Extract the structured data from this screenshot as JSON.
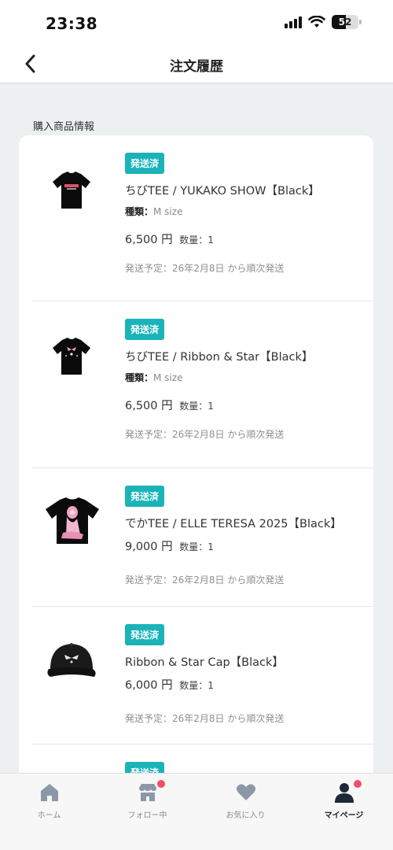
{
  "status_bar": {
    "time": "23:38",
    "battery": "52"
  },
  "header": {
    "title": "注文履歴"
  },
  "section": {
    "label": "購入商品情報"
  },
  "items": [
    {
      "status": "発送済",
      "name": "ちびTEE / YUKAKO SHOW【Black】",
      "variant_label": "種類：",
      "variant_value": "M size",
      "price": "6,500 円",
      "qty": "数量：1",
      "ship": "発送予定：26年2月8日 から順次発送"
    },
    {
      "status": "発送済",
      "name": "ちびTEE / Ribbon & Star【Black】",
      "variant_label": "種類：",
      "variant_value": "M size",
      "price": "6,500 円",
      "qty": "数量：1",
      "ship": "発送予定：26年2月8日 から順次発送"
    },
    {
      "status": "発送済",
      "name": "でかTEE / ELLE TERESA 2025【Black】",
      "price": "9,000 円",
      "qty": "数量：1",
      "ship": "発送予定：26年2月8日 から順次発送"
    },
    {
      "status": "発送済",
      "name": "Ribbon & Star Cap【Black】",
      "price": "6,000 円",
      "qty": "数量：1",
      "ship": "発送予定：26年2月8日 から順次発送"
    },
    {
      "status": "発送済"
    }
  ],
  "nav": [
    {
      "label": "ホーム",
      "icon": "home-icon"
    },
    {
      "label": "フォロー中",
      "icon": "shop-icon",
      "dot": true
    },
    {
      "label": "お気に入り",
      "icon": "heart-icon"
    },
    {
      "label": "マイページ",
      "icon": "person-icon",
      "dot": true,
      "active": true
    }
  ],
  "colors": {
    "accent": "#1ab3b8",
    "notify": "#ef4f6a",
    "background": "#ecf0f1"
  }
}
